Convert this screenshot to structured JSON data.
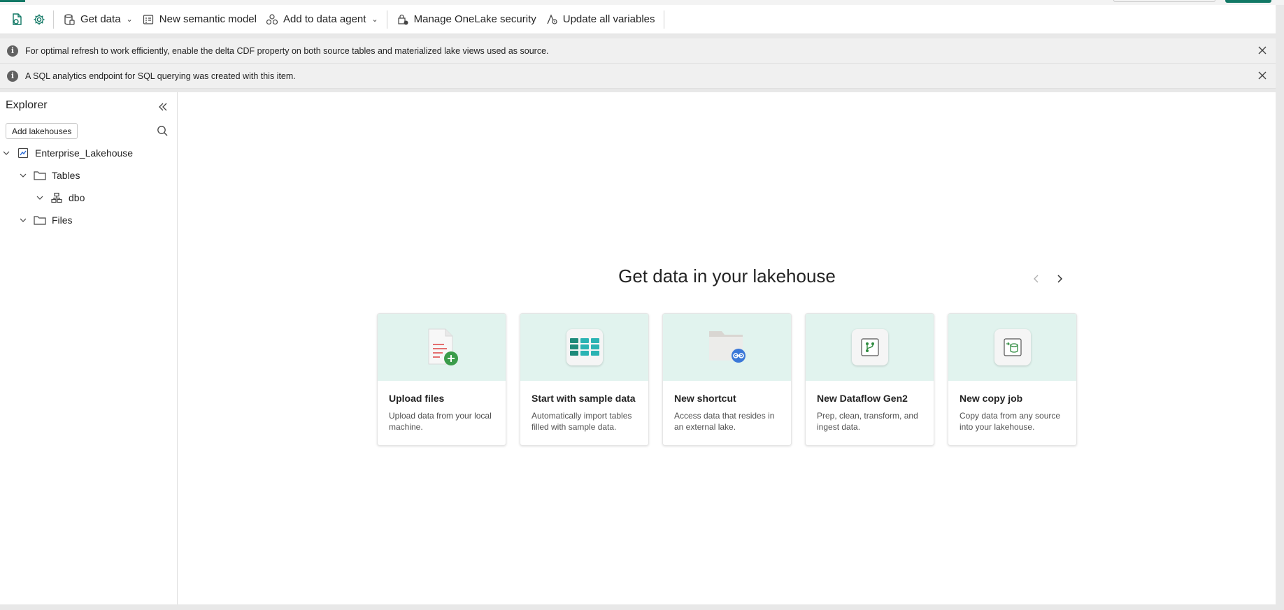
{
  "toolbar": {
    "get_data_label": "Get data",
    "new_semantic_model_label": "New semantic model",
    "add_to_data_agent_label": "Add to data agent",
    "manage_onelake_security_label": "Manage OneLake security",
    "update_all_variables_label": "Update all variables"
  },
  "banners": [
    {
      "text": "For optimal refresh to work efficiently, enable the delta CDF property on both source tables and materialized lake views used as source."
    },
    {
      "text": "A SQL analytics endpoint for SQL querying was created with this item."
    }
  ],
  "explorer": {
    "title": "Explorer",
    "add_lakehouses_label": "Add lakehouses",
    "tree": {
      "lakehouse": "Enterprise_Lakehouse",
      "tables": "Tables",
      "schema": "dbo",
      "files": "Files"
    }
  },
  "main": {
    "heading": "Get data in your lakehouse",
    "cards": [
      {
        "title": "Upload files",
        "description": "Upload data from your local machine."
      },
      {
        "title": "Start with sample data",
        "description": "Automatically import tables filled with sample data."
      },
      {
        "title": "New shortcut",
        "description": "Access data that resides in an external lake."
      },
      {
        "title": "New Dataflow Gen2",
        "description": "Prep, clean, transform, and ingest data."
      },
      {
        "title": "New copy job",
        "description": "Copy data from any source into your lakehouse."
      }
    ]
  },
  "colors": {
    "accent": "#117865",
    "card_header": "#e1f3ee",
    "banner_bg": "#f0f0f0"
  }
}
